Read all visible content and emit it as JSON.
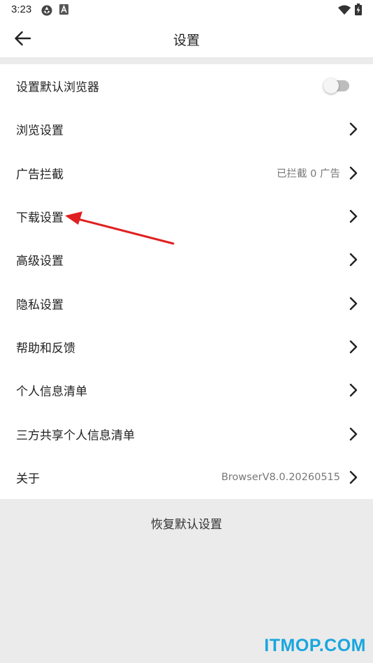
{
  "status_bar": {
    "time": "3:23",
    "icons": [
      "sync-icon",
      "a-box-icon",
      "wifi-icon",
      "battery-charging-icon"
    ]
  },
  "header": {
    "title": "设置",
    "back_icon": "arrow-left-icon"
  },
  "settings": {
    "items": [
      {
        "label": "设置默认浏览器",
        "control": "toggle",
        "toggle_on": false
      },
      {
        "label": "浏览设置",
        "control": "chevron"
      },
      {
        "label": "广告拦截",
        "value": "已拦截 0 广告",
        "control": "chevron"
      },
      {
        "label": "下载设置",
        "control": "chevron"
      },
      {
        "label": "高级设置",
        "control": "chevron"
      },
      {
        "label": "隐私设置",
        "control": "chevron"
      },
      {
        "label": "帮助和反馈",
        "control": "chevron"
      },
      {
        "label": "个人信息清单",
        "control": "chevron"
      },
      {
        "label": "三方共享个人信息清单",
        "control": "chevron"
      },
      {
        "label": "关于",
        "value": "BrowserV8.0.20260515",
        "control": "chevron"
      }
    ]
  },
  "footer": {
    "reset_label": "恢复默认设置"
  },
  "watermark": "ITMOP.COM",
  "colors": {
    "annotation_arrow": "#e02020",
    "watermark": "#19a6de",
    "background": "#ebebeb"
  }
}
